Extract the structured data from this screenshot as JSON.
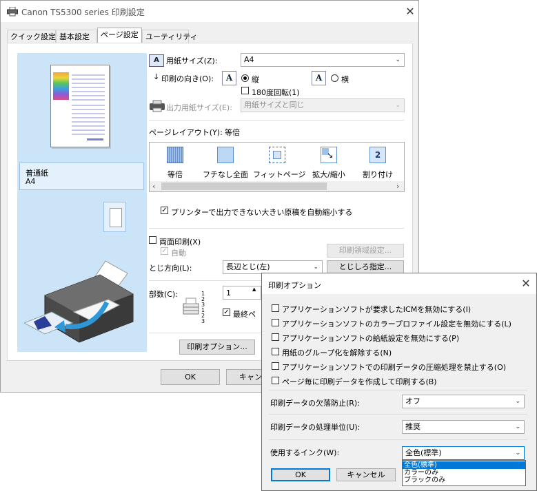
{
  "main_window": {
    "title": "Canon TS5300 series 印刷設定",
    "tabs": [
      {
        "label": "クイック設定"
      },
      {
        "label": "基本設定"
      },
      {
        "label": "ページ設定"
      },
      {
        "label": "ユーティリティ"
      }
    ],
    "preview": {
      "paper_type": "普通紙",
      "paper_size": "A4"
    },
    "paper_size": {
      "label": "用紙サイズ(Z):",
      "value": "A4"
    },
    "orientation": {
      "label": "印刷の向き(O):",
      "portrait": "縦",
      "landscape": "横",
      "selected": "portrait",
      "rotate180": "180度回転(1)",
      "rotate180_checked": false
    },
    "output_paper_size": {
      "label": "出力用紙サイズ(E):",
      "value": "用紙サイズと同じ"
    },
    "page_layout": {
      "label": "ページレイアウト(Y):",
      "current": "等倍",
      "items": [
        {
          "label": "等倍",
          "icon": "normal-size-icon"
        },
        {
          "label": "フチなし全面",
          "icon": "borderless-icon"
        },
        {
          "label": "フィットページ",
          "icon": "fit-to-page-icon"
        },
        {
          "label": "拡大/縮小",
          "icon": "scaled-icon"
        },
        {
          "label": "割り付け",
          "icon": "page-layout-2-icon",
          "badge": "2"
        }
      ]
    },
    "auto_reduce": {
      "label": "プリンターで出力できない大きい原稿を自動縮小する",
      "checked": true
    },
    "duplex": {
      "label": "両面印刷(X)",
      "checked": false,
      "auto_label": "自動",
      "auto_checked": true
    },
    "print_area_button": "印刷領域設定...",
    "binding": {
      "label": "とじ方向(L):",
      "value": "長辺とじ(左)",
      "button": "とじしろ指定..."
    },
    "copies": {
      "label": "部数(C):",
      "value": "1",
      "collate_label": "最終ペ",
      "collate_checked": true,
      "stack_digits": "123 123"
    },
    "print_options_button": "印刷オプション...",
    "ok_button": "OK",
    "cancel_button": "キャンセル"
  },
  "options_dialog": {
    "title": "印刷オプション",
    "checkboxes": [
      {
        "label": "アプリケーションソフトが要求したICMを無効にする(I)",
        "checked": false
      },
      {
        "label": "アプリケーションソフトのカラープロファイル設定を無効にする(L)",
        "checked": false
      },
      {
        "label": "アプリケーションソフトの給紙設定を無効にする(P)",
        "checked": false
      },
      {
        "label": "用紙のグループ化を解除する(N)",
        "checked": false
      },
      {
        "label": "アプリケーションソフトでの印刷データの圧縮処理を禁止する(O)",
        "checked": false
      },
      {
        "label": "ページ毎に印刷データを作成して印刷する(B)",
        "checked": false
      }
    ],
    "dropout_prevention": {
      "label": "印刷データの欠落防止(R):",
      "value": "オフ"
    },
    "processing_unit": {
      "label": "印刷データの処理単位(U):",
      "value": "推奨"
    },
    "ink": {
      "label": "使用するインク(W):",
      "value": "全色(標準)",
      "options": [
        "全色(標準)",
        "カラーのみ",
        "ブラックのみ"
      ],
      "highlighted_index": 0
    },
    "ok_button": "OK",
    "cancel_button": "キャンセル"
  },
  "colors": {
    "accent": "#0078d7",
    "preview_bg": "#cce4f7",
    "selection": "#0078d7"
  }
}
